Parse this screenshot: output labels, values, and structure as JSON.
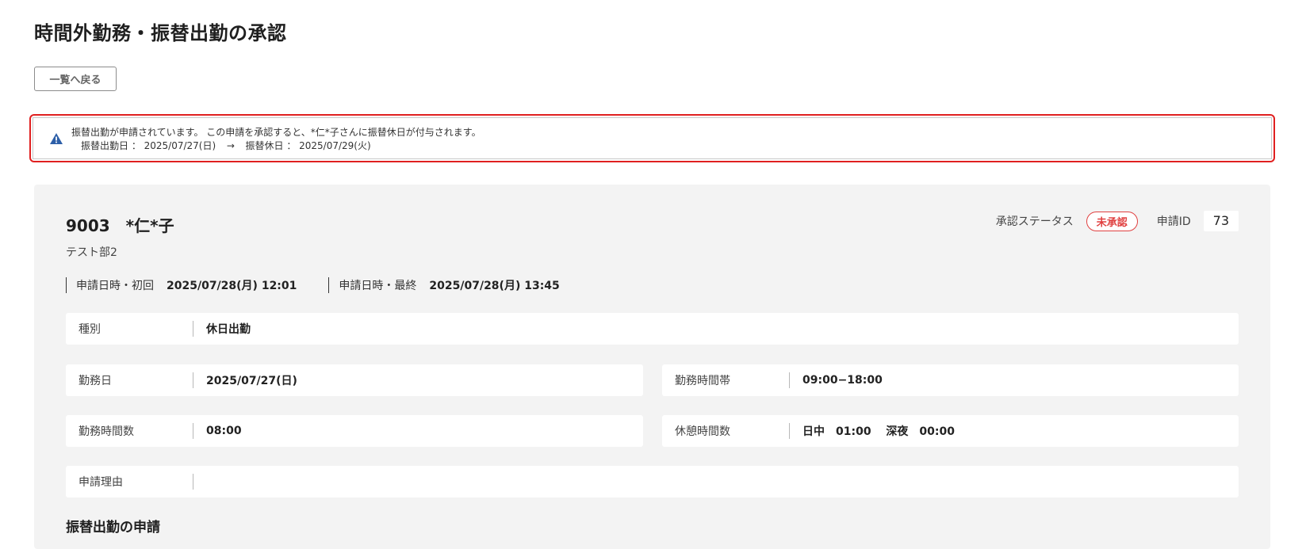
{
  "page": {
    "title": "時間外勤務・振替出勤の承認",
    "back_button": "一覧へ戻る"
  },
  "alert": {
    "icon": "warning-icon",
    "message": "振替出勤が申請されています。 この申請を承認すると、*仁*子さんに振替休日が付与されます。",
    "work_date_label": "振替出勤日 ： 2025/07/27(日)",
    "arrow": "→",
    "holiday_label": "振替休日 ： 2025/07/29(火)",
    "colors": {
      "frame": "#e02020",
      "icon": "#2d5fa8"
    }
  },
  "employee": {
    "code": "9003",
    "name": "*仁*子",
    "department": "テスト部2"
  },
  "status": {
    "label": "承認ステータス",
    "value": "未承認",
    "color": "#e04040",
    "id_label": "申請ID",
    "id_value": "73"
  },
  "dates": {
    "first_label": "申請日時・初回",
    "first_value": "2025/07/28(月) 12:01",
    "last_label": "申請日時・最終",
    "last_value": "2025/07/28(月) 13:45"
  },
  "fields": {
    "type": {
      "label": "種別",
      "value": "休日出勤"
    },
    "work_date": {
      "label": "勤務日",
      "value": "2025/07/27(日)"
    },
    "work_time_band": {
      "label": "勤務時間帯",
      "value": "09:00−18:00"
    },
    "work_hours": {
      "label": "勤務時間数",
      "value": "08:00"
    },
    "break_hours": {
      "label": "休憩時間数",
      "value": "日中　01:00　 深夜　00:00"
    },
    "reason": {
      "label": "申請理由",
      "value": ""
    }
  },
  "section": {
    "title": "振替出勤の申請"
  }
}
